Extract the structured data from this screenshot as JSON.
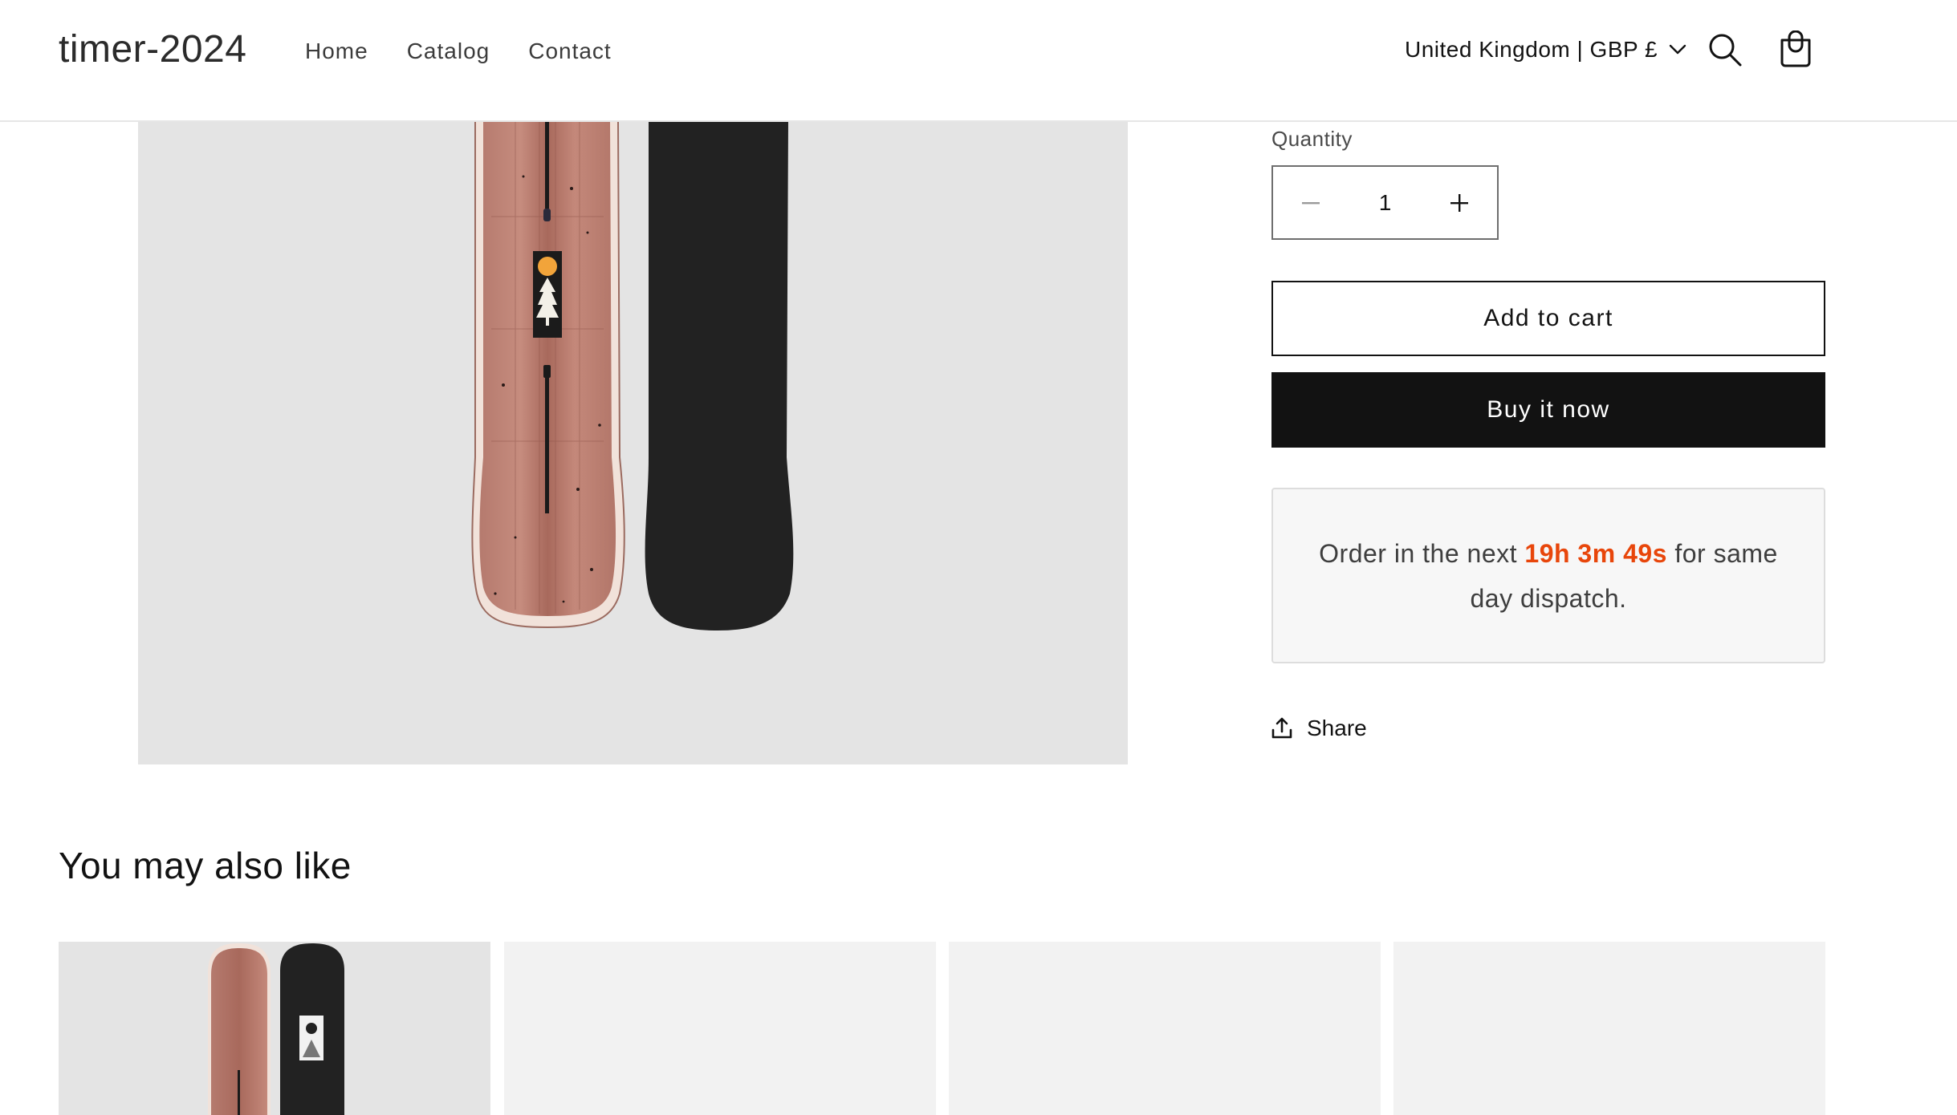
{
  "header": {
    "logo": "timer-2024",
    "nav": [
      "Home",
      "Catalog",
      "Contact"
    ],
    "country_selector": "United Kingdom | GBP £",
    "icons": {
      "search": "search-icon",
      "cart": "cart-icon",
      "country_chevron": "chevron-down-icon"
    }
  },
  "product": {
    "media_alt": "snowboard-image",
    "quantity": {
      "label": "Quantity",
      "value": "1",
      "decrease_icon": "minus-icon",
      "increase_icon": "plus-icon"
    },
    "add_to_cart_label": "Add to cart",
    "buy_now_label": "Buy it now",
    "timer": {
      "prefix": "Order in the next",
      "countdown": "19h 3m 49s",
      "suffix": "for same day dispatch.",
      "countdown_color": "#e8460b"
    },
    "share_label": "Share",
    "share_icon": "share-icon"
  },
  "related": {
    "title": "You may also like",
    "cards": [
      {
        "image": "snowboard-thumbnail"
      },
      {
        "image": "placeholder"
      },
      {
        "image": "placeholder"
      },
      {
        "image": "placeholder"
      }
    ]
  },
  "colors": {
    "accent_timer": "#e8460b",
    "button_dark": "#121212",
    "media_bg": "#e4e4e4"
  }
}
